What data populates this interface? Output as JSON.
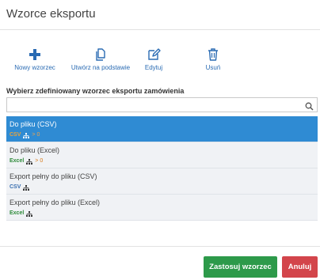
{
  "dialog": {
    "title": "Wzorce eksportu"
  },
  "toolbar": {
    "new_label": "Nowy wzorzec",
    "copy_label": "Utwórz na podstawie",
    "edit_label": "Edytuj",
    "delete_label": "Usuń"
  },
  "prompt": "Wybierz zdefiniowany wzorzec eksportu zamówienia",
  "search": {
    "value": "",
    "placeholder": ""
  },
  "templates": [
    {
      "name": "Do pliku (CSV)",
      "format": "CSV",
      "rule": "> 0",
      "selected": true
    },
    {
      "name": "Do pliku (Excel)",
      "format": "Excel",
      "rule": "> 0",
      "selected": false
    },
    {
      "name": "Export pełny do pliku (CSV)",
      "format": "CSV",
      "rule": "",
      "selected": false
    },
    {
      "name": "Export pełny do pliku (Excel)",
      "format": "Excel",
      "rule": "",
      "selected": false
    }
  ],
  "footer": {
    "apply_label": "Zastosuj wzorzec",
    "cancel_label": "Anuluj"
  },
  "colors": {
    "accent_blue": "#2f8bd3",
    "apply_green": "#2d9a4a",
    "cancel_red": "#d3454b",
    "toolbar_icon": "#2a6bb3"
  },
  "icons": [
    "plus-icon",
    "copy-icon",
    "edit-icon",
    "trash-icon",
    "search-icon",
    "hierarchy-icon"
  ]
}
